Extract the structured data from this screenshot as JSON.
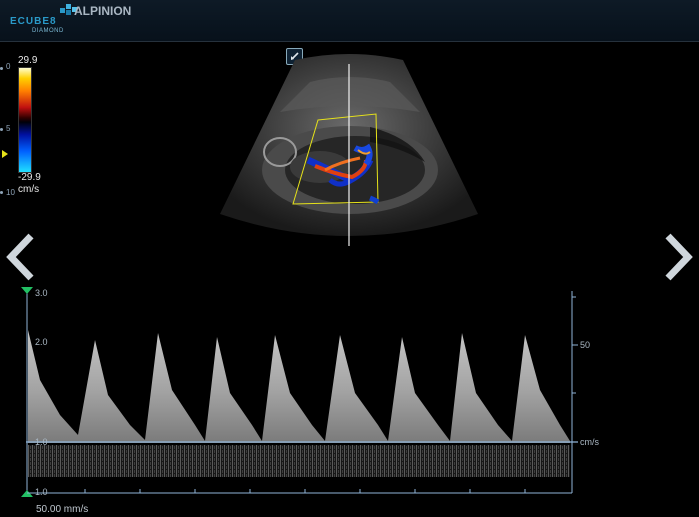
{
  "header": {
    "logo_main": "ECUBE8",
    "logo_sub": "DIAMOND",
    "brand": "ALPINION"
  },
  "depth_scale": [
    "0",
    "5",
    "10"
  ],
  "color_scale": {
    "max": "29.9",
    "min": "-29.9",
    "unit": "cm/s"
  },
  "doppler": {
    "left_ticks": [
      "3.0",
      "2.0",
      "1.0",
      "1.0"
    ],
    "right_ticks": [
      "50"
    ],
    "unit": "cm/s",
    "sweep_speed": "50.00 mm/s"
  },
  "navigation": {
    "prev_icon": "chevron-left-icon",
    "next_icon": "chevron-right-icon"
  },
  "colors": {
    "header_bg": "#0b1620",
    "baseline": "#8fb4d8",
    "roi_box": "#e6e21a",
    "marker_green": "#22c064",
    "depth_marker": "#e6e21a"
  }
}
